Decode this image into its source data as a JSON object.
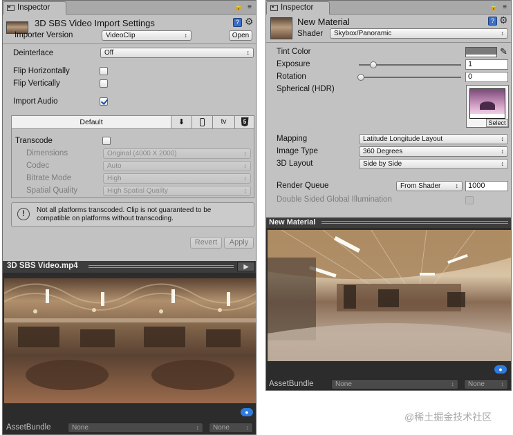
{
  "left": {
    "tab_label": "Inspector",
    "asset_title": "3D SBS Video Import Settings",
    "open_label": "Open",
    "importer_version_label": "Importer Version",
    "importer_version_value": "VideoClip",
    "deinterlace_label": "Deinterlace",
    "deinterlace_value": "Off",
    "flip_h_label": "Flip Horizontally",
    "flip_v_label": "Flip Vertically",
    "import_audio_label": "Import Audio",
    "flip_h_checked": false,
    "flip_v_checked": false,
    "import_audio_checked": true,
    "platform_tab_default": "Default",
    "platform_tab_tv": "tv",
    "transcode_label": "Transcode",
    "transcode_checked": false,
    "dimensions_label": "Dimensions",
    "dimensions_value": "Original (4000 X 2000)",
    "codec_label": "Codec",
    "codec_value": "Auto",
    "bitrate_label": "Bitrate Mode",
    "bitrate_value": "High",
    "spatial_label": "Spatial Quality",
    "spatial_value": "High Spatial Quality",
    "warning_text": "Not all platforms transcoded. Clip is not guaranteed to be compatible on platforms without transcoding.",
    "revert_label": "Revert",
    "apply_label": "Apply",
    "preview_title": "3D SBS Video.mp4",
    "assetbundle_label": "AssetBundle",
    "assetbundle_value": "None",
    "assetbundle_variant": "None"
  },
  "right": {
    "tab_label": "Inspector",
    "material_title": "New Material",
    "shader_label": "Shader",
    "shader_value": "Skybox/Panoramic",
    "tint_label": "Tint Color",
    "exposure_label": "Exposure",
    "exposure_value": "1",
    "rotation_label": "Rotation",
    "rotation_value": "0",
    "spherical_label": "Spherical  (HDR)",
    "select_label": "Select",
    "mapping_label": "Mapping",
    "mapping_value": "Latitude Longitude Layout",
    "imagetype_label": "Image Type",
    "imagetype_value": "360 Degrees",
    "layout_label": "3D Layout",
    "layout_value": "Side by Side",
    "renderqueue_label": "Render Queue",
    "renderqueue_source": "From Shader",
    "renderqueue_value": "1000",
    "gi_label": "Double Sided Global Illumination",
    "gi_checked": false,
    "preview_title": "New Material",
    "assetbundle_label": "AssetBundle",
    "assetbundle_value": "None",
    "assetbundle_variant": "None"
  },
  "watermark": "@稀土掘金技术社区",
  "colors": {
    "panel_bg": "#c2c2c2",
    "dark_header": "#3c3c3c",
    "tag_blue": "#2f7cdc"
  }
}
